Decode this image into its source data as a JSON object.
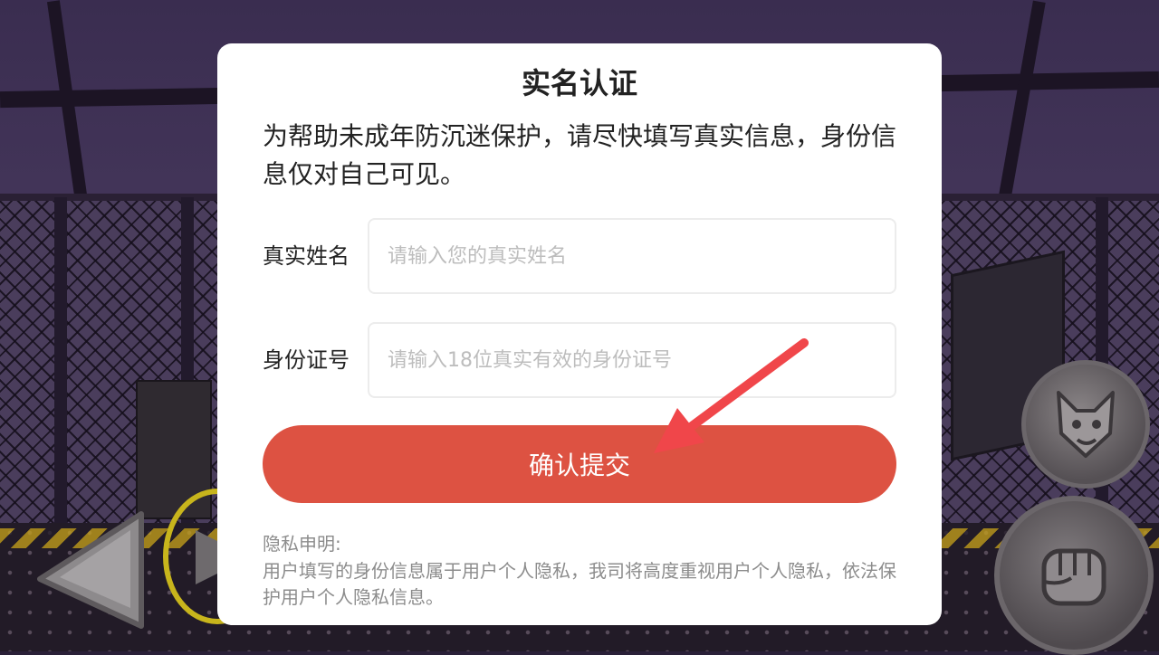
{
  "dialog": {
    "title": "实名认证",
    "description": "为帮助未成年防沉迷保护，请尽快填写真实信息，身份信息仅对自己可见。",
    "name_field": {
      "label": "真实姓名",
      "placeholder": "请输入您的真实姓名",
      "value": ""
    },
    "id_field": {
      "label": "身份证号",
      "placeholder": "请输入18位真实有效的身份证号",
      "value": ""
    },
    "submit_label": "确认提交",
    "privacy_title": "隐私申明:",
    "privacy_text": "用户填写的身份信息属于用户个人隐私，我司将高度重视用户个人隐私，依法保护用户个人隐私信息。"
  },
  "colors": {
    "primary_button": "#dd5242",
    "annotation_arrow": "#f0464a",
    "placeholder": "#bdbdbd",
    "muted_text": "#8c8c8c"
  },
  "icons": {
    "move_left": "left-arrow-icon",
    "move_right": "right-arrow-icon",
    "skill": "wolf-face-icon",
    "attack": "fist-icon",
    "annotation": "pointer-arrow-icon"
  }
}
